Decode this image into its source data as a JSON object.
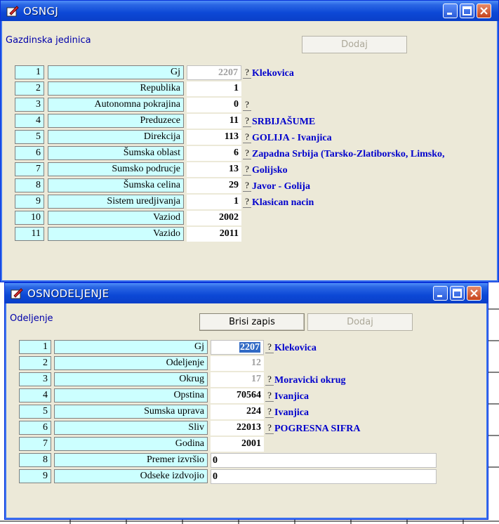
{
  "window1": {
    "title": "OSNGJ",
    "caption": "Gazdinska jedinica",
    "add_label": "Dodaj",
    "rows": [
      {
        "num": "1",
        "label": "Gj",
        "value": "2207",
        "desc": "Klekovica"
      },
      {
        "num": "2",
        "label": "Republika",
        "value": "1",
        "desc": ""
      },
      {
        "num": "3",
        "label": "Autonomna pokrajina",
        "value": "0",
        "desc": ""
      },
      {
        "num": "4",
        "label": "Preduzece",
        "value": "11",
        "desc": "SRBIJAŠUME"
      },
      {
        "num": "5",
        "label": "Direkcija",
        "value": "113",
        "desc": "GOLIJA - Ivanjica"
      },
      {
        "num": "6",
        "label": "Šumska oblast",
        "value": "6",
        "desc": "Zapadna Srbija (Tarsko-Zlatiborsko, Limsko,"
      },
      {
        "num": "7",
        "label": "Sumsko podrucje",
        "value": "13",
        "desc": "Golijsko"
      },
      {
        "num": "8",
        "label": "Šumska celina",
        "value": "29",
        "desc": "Javor - Golija"
      },
      {
        "num": "9",
        "label": "Sistem uredjivanja",
        "value": "1",
        "desc": "Klasican nacin"
      },
      {
        "num": "10",
        "label": "Vaziod",
        "value": "2002",
        "desc": ""
      },
      {
        "num": "11",
        "label": "Vazido",
        "value": "2011",
        "desc": ""
      }
    ]
  },
  "window2": {
    "title": "OSNODELJENJE",
    "caption": "Odeljenje",
    "delete_label": "Brisi zapis",
    "add_label": "Dodaj",
    "rows": [
      {
        "num": "1",
        "label": "Gj",
        "value": "2207",
        "desc": "Klekovica"
      },
      {
        "num": "2",
        "label": "Odeljenje",
        "value": "12",
        "desc": ""
      },
      {
        "num": "3",
        "label": "Okrug",
        "value": "17",
        "desc": "Moravicki okrug"
      },
      {
        "num": "4",
        "label": "Opstina",
        "value": "70564",
        "desc": "Ivanjica"
      },
      {
        "num": "5",
        "label": "Sumska uprava",
        "value": "224",
        "desc": "Ivanjica"
      },
      {
        "num": "6",
        "label": "Sliv",
        "value": "22013",
        "desc": "POGRESNA SIFRA"
      },
      {
        "num": "7",
        "label": "Godina",
        "value": "2001",
        "desc": ""
      },
      {
        "num": "8",
        "label": "Premer izvršio",
        "value": "0",
        "desc": ""
      },
      {
        "num": "9",
        "label": "Odseke izdvojio",
        "value": "0",
        "desc": ""
      }
    ]
  },
  "help_glyph": "?",
  "colors": {
    "title_bar": "#0a3fc8",
    "field_cyan": "#ccffff",
    "desc_blue": "#0000cc",
    "selection": "#316ac5"
  }
}
